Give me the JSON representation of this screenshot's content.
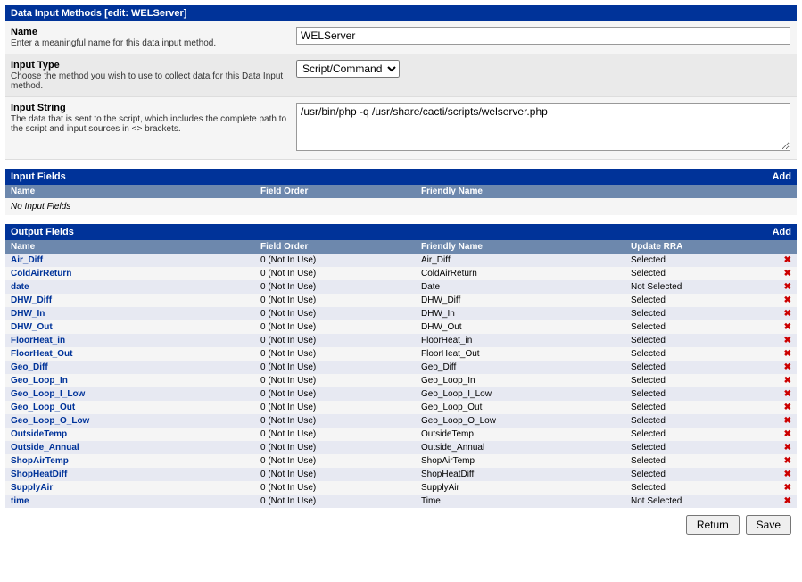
{
  "panel_title": "Data Input Methods [edit: WELServer]",
  "form": {
    "name": {
      "label": "Name",
      "desc": "Enter a meaningful name for this data input method.",
      "value": "WELServer"
    },
    "input_type": {
      "label": "Input Type",
      "desc": "Choose the method you wish to use to collect data for this Data Input method.",
      "value": "Script/Command"
    },
    "input_string": {
      "label": "Input String",
      "desc": "The data that is sent to the script, which includes the complete path to the script and input sources in <> brackets.",
      "value": "/usr/bin/php -q /usr/share/cacti/scripts/welserver.php"
    }
  },
  "input_fields": {
    "title": "Input Fields",
    "add_label": "Add",
    "cols": {
      "name": "Name",
      "order": "Field Order",
      "friendly": "Friendly Name"
    },
    "none": "No Input Fields"
  },
  "output_fields": {
    "title": "Output Fields",
    "add_label": "Add",
    "cols": {
      "name": "Name",
      "order": "Field Order",
      "friendly": "Friendly Name",
      "rra": "Update RRA"
    },
    "rows": [
      {
        "name": "Air_Diff",
        "order": "0 (Not In Use)",
        "friendly": "Air_Diff",
        "rra": "Selected"
      },
      {
        "name": "ColdAirReturn",
        "order": "0 (Not In Use)",
        "friendly": "ColdAirReturn",
        "rra": "Selected"
      },
      {
        "name": "date",
        "order": "0 (Not In Use)",
        "friendly": "Date",
        "rra": "Not Selected"
      },
      {
        "name": "DHW_Diff",
        "order": "0 (Not In Use)",
        "friendly": "DHW_Diff",
        "rra": "Selected"
      },
      {
        "name": "DHW_In",
        "order": "0 (Not In Use)",
        "friendly": "DHW_In",
        "rra": "Selected"
      },
      {
        "name": "DHW_Out",
        "order": "0 (Not In Use)",
        "friendly": "DHW_Out",
        "rra": "Selected"
      },
      {
        "name": "FloorHeat_in",
        "order": "0 (Not In Use)",
        "friendly": "FloorHeat_in",
        "rra": "Selected"
      },
      {
        "name": "FloorHeat_Out",
        "order": "0 (Not In Use)",
        "friendly": "FloorHeat_Out",
        "rra": "Selected"
      },
      {
        "name": "Geo_Diff",
        "order": "0 (Not In Use)",
        "friendly": "Geo_Diff",
        "rra": "Selected"
      },
      {
        "name": "Geo_Loop_In",
        "order": "0 (Not In Use)",
        "friendly": "Geo_Loop_In",
        "rra": "Selected"
      },
      {
        "name": "Geo_Loop_I_Low",
        "order": "0 (Not In Use)",
        "friendly": "Geo_Loop_I_Low",
        "rra": "Selected"
      },
      {
        "name": "Geo_Loop_Out",
        "order": "0 (Not In Use)",
        "friendly": "Geo_Loop_Out",
        "rra": "Selected"
      },
      {
        "name": "Geo_Loop_O_Low",
        "order": "0 (Not In Use)",
        "friendly": "Geo_Loop_O_Low",
        "rra": "Selected"
      },
      {
        "name": "OutsideTemp",
        "order": "0 (Not In Use)",
        "friendly": "OutsideTemp",
        "rra": "Selected"
      },
      {
        "name": "Outside_Annual",
        "order": "0 (Not In Use)",
        "friendly": "Outside_Annual",
        "rra": "Selected"
      },
      {
        "name": "ShopAirTemp",
        "order": "0 (Not In Use)",
        "friendly": "ShopAirTemp",
        "rra": "Selected"
      },
      {
        "name": "ShopHeatDiff",
        "order": "0 (Not In Use)",
        "friendly": "ShopHeatDiff",
        "rra": "Selected"
      },
      {
        "name": "SupplyAir",
        "order": "0 (Not In Use)",
        "friendly": "SupplyAir",
        "rra": "Selected"
      },
      {
        "name": "time",
        "order": "0 (Not In Use)",
        "friendly": "Time",
        "rra": "Not Selected"
      }
    ]
  },
  "buttons": {
    "return": "Return",
    "save": "Save"
  },
  "icons": {
    "delete_glyph": "✖"
  }
}
